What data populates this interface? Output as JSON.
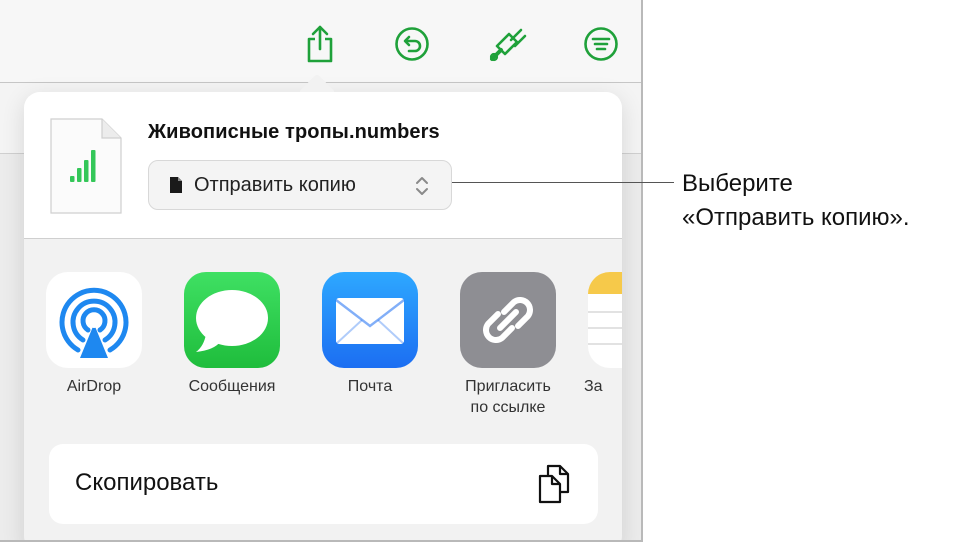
{
  "toolbar": {
    "icons": [
      "share-icon",
      "undo-icon",
      "format-brush-icon",
      "organize-icon"
    ],
    "accent_color": "#1fa13a"
  },
  "share_sheet": {
    "file_name": "Живописные тропы.numbers",
    "send_option": "Отправить копию",
    "apps": [
      {
        "label": "AirDrop",
        "icon": "airdrop-icon"
      },
      {
        "label": "Сообщения",
        "icon": "messages-icon"
      },
      {
        "label": "Почта",
        "icon": "mail-icon"
      },
      {
        "label": "Пригласить\nпо ссылке",
        "icon": "link-icon"
      },
      {
        "label": "За",
        "icon": "notes-icon"
      }
    ],
    "copy_action": "Скопировать"
  },
  "callout": {
    "text_line1": "Выберите",
    "text_line2": "«Отправить копию»."
  }
}
